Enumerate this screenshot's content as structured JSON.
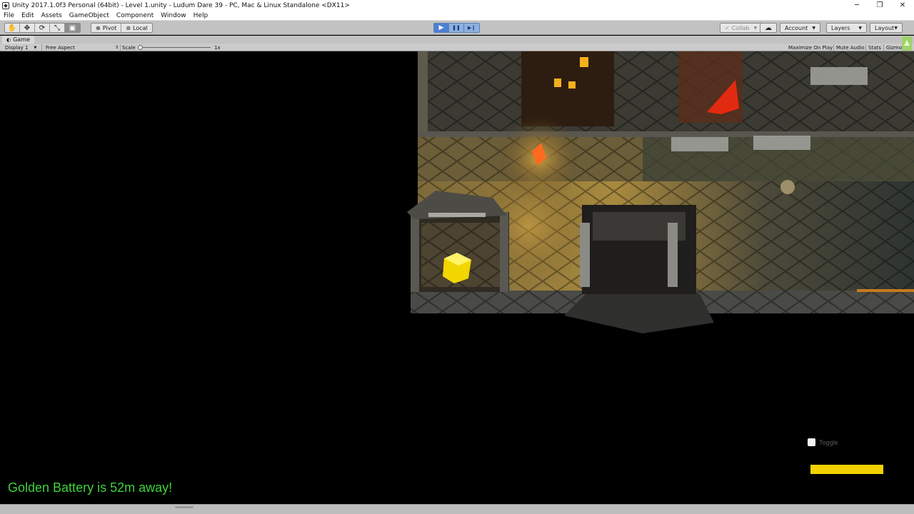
{
  "window": {
    "title": "Unity 2017.1.0f3 Personal (64bit) - Level 1.unity - Ludum Dare 39 - PC, Mac & Linux Standalone <DX11>",
    "controls": {
      "minimize": "─",
      "restore": "❐",
      "close": "✕"
    }
  },
  "menu": {
    "items": [
      "File",
      "Edit",
      "Assets",
      "GameObject",
      "Component",
      "Window",
      "Help"
    ]
  },
  "toolbar": {
    "tools": [
      {
        "name": "hand-tool-button",
        "icon": "✋"
      },
      {
        "name": "move-tool-button",
        "icon": "✥"
      },
      {
        "name": "rotate-tool-button",
        "icon": "⟳"
      },
      {
        "name": "scale-tool-button",
        "icon": "⤡"
      },
      {
        "name": "rect-tool-button",
        "icon": "▣"
      }
    ],
    "pivot_label": "Pivot",
    "local_label": "Local",
    "play_icon": "▶",
    "pause_icon": "❚❚",
    "step_icon": "▶❙",
    "collab_label": "Collab",
    "cloud_icon": "☁",
    "account_label": "Account",
    "layers_label": "Layers",
    "layout_label": "Layout"
  },
  "game_tab": {
    "icon": "◐",
    "label": "Game"
  },
  "game_bar": {
    "display": "Display 1",
    "aspect": "Free Aspect",
    "scale_label": "Scale",
    "scale_value": "1x",
    "maximize_on_play": "Maximize On Play",
    "mute_audio": "Mute Audio",
    "stats": "Stats",
    "gizmos": "Gizmos"
  },
  "hud": {
    "toggle_label": "Toggle",
    "battery_fill": 1.0,
    "message": "Golden Battery is 52m away!"
  },
  "colors": {
    "hud_message": "#3fd23a",
    "battery_bar": "#f1d200",
    "play_active": "#4d7fd3"
  }
}
